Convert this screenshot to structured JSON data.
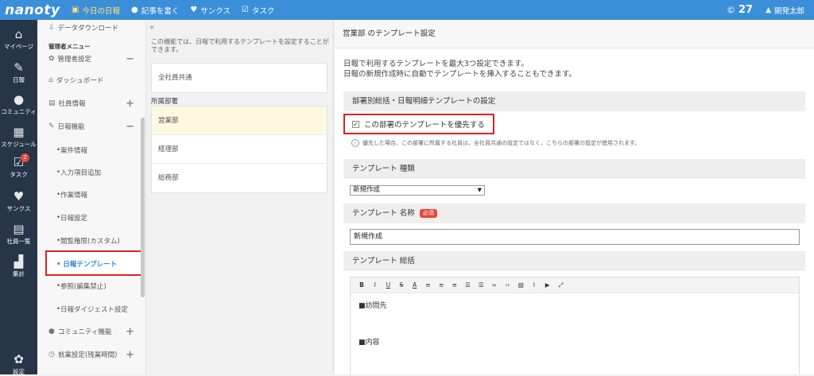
{
  "top": {
    "logo": "nanoty",
    "nav": [
      {
        "label": "今日の日報",
        "icon": "calendar-icon",
        "active": true
      },
      {
        "label": "記事を書く",
        "icon": "chat-icon",
        "active": false
      },
      {
        "label": "サンクス",
        "icon": "heart-icon",
        "active": false
      },
      {
        "label": "タスク",
        "icon": "checkbox-icon",
        "active": false
      }
    ],
    "points_symbol": "©",
    "points": "27",
    "user_name": "開発太郎"
  },
  "leftnav": [
    {
      "label": "マイページ",
      "icon": "home-icon"
    },
    {
      "label": "日報",
      "icon": "report-icon"
    },
    {
      "label": "コミュニティ",
      "icon": "community-icon"
    },
    {
      "label": "スケジュール",
      "icon": "calendar-grid-icon"
    },
    {
      "label": "タスク",
      "icon": "task-icon",
      "badge": "2"
    },
    {
      "label": "サンクス",
      "icon": "heart-icon"
    },
    {
      "label": "社員一覧",
      "icon": "id-card-icon"
    },
    {
      "label": "集計",
      "icon": "bar-chart-icon"
    },
    {
      "label": "設定",
      "icon": "gear-icon"
    }
  ],
  "menu": {
    "download": "データダウンロード",
    "admin_menu": "管理者メニュー",
    "admin_settings": "管理者設定",
    "dashboard": "ダッシュボード",
    "employee_info": "社員情報",
    "report_feature": "日報機能",
    "items": [
      "案件情報",
      "入力項目追加",
      "作業情報",
      "日報設定",
      "閲覧権限(カスタム)",
      "日報テンプレート",
      "参照(編集禁止)",
      "日報ダイジェスト設定"
    ],
    "community": "コミュニティ機能",
    "work_settings": "就業設定(残業時間)"
  },
  "mid": {
    "description": "この機能では、日報で利用するテンプレートを設定することができます。",
    "all_employees": "全社員共通",
    "group_label": "所属部署",
    "departments": [
      "営業部",
      "経理部",
      "総務部"
    ]
  },
  "main": {
    "title": "営業部 のテンプレート設定",
    "intro_line1": "日報で利用するテンプレートを最大3つ設定できます。",
    "intro_line2": "日報の新規作成時に自動でテンプレートを挿入することもできます。",
    "section1": "部署別総括・日報明細テンプレートの設定",
    "priority_checkbox": "この部署のテンプレートを優先する",
    "priority_checked": true,
    "priority_note": "優先した場合、この部署に所属する社員は、全社員共通の設定ではなく、こちらの部署の設定が使用されます。",
    "section_type": "テンプレート 種類",
    "type_value": "新規作成",
    "section_name": "テンプレート 名称",
    "required": "必須",
    "name_value": "新規作成",
    "section_summary": "テンプレート 総括",
    "editor_lines": [
      "■訪問先",
      "■内容"
    ]
  },
  "colors": {
    "topbar": "#3b8fd8",
    "sidebar": "#263648",
    "accent": "#2f89d6",
    "highlight": "#e02020",
    "badge": "#e8463b"
  }
}
